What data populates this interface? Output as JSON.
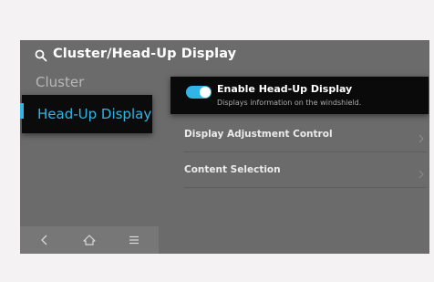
{
  "header": {
    "title": "Cluster/Head-Up Display",
    "icon": "search-icon"
  },
  "sidebar": {
    "items": [
      {
        "label": "Cluster",
        "active": false
      },
      {
        "label": "Head-Up Display",
        "active": true
      }
    ],
    "accent_color": "#31b5e6"
  },
  "bottom_nav": {
    "items": [
      {
        "icon": "back-icon"
      },
      {
        "icon": "home-icon"
      },
      {
        "icon": "menu-icon"
      }
    ]
  },
  "content": {
    "toggle": {
      "label": "Enable Head-Up Display",
      "description": "Displays information on the windshield.",
      "enabled": true
    },
    "rows": [
      {
        "label": "Display Adjustment Control",
        "icon": "chevron-right-icon"
      },
      {
        "label": "Content Selection",
        "icon": "chevron-right-icon"
      }
    ]
  }
}
